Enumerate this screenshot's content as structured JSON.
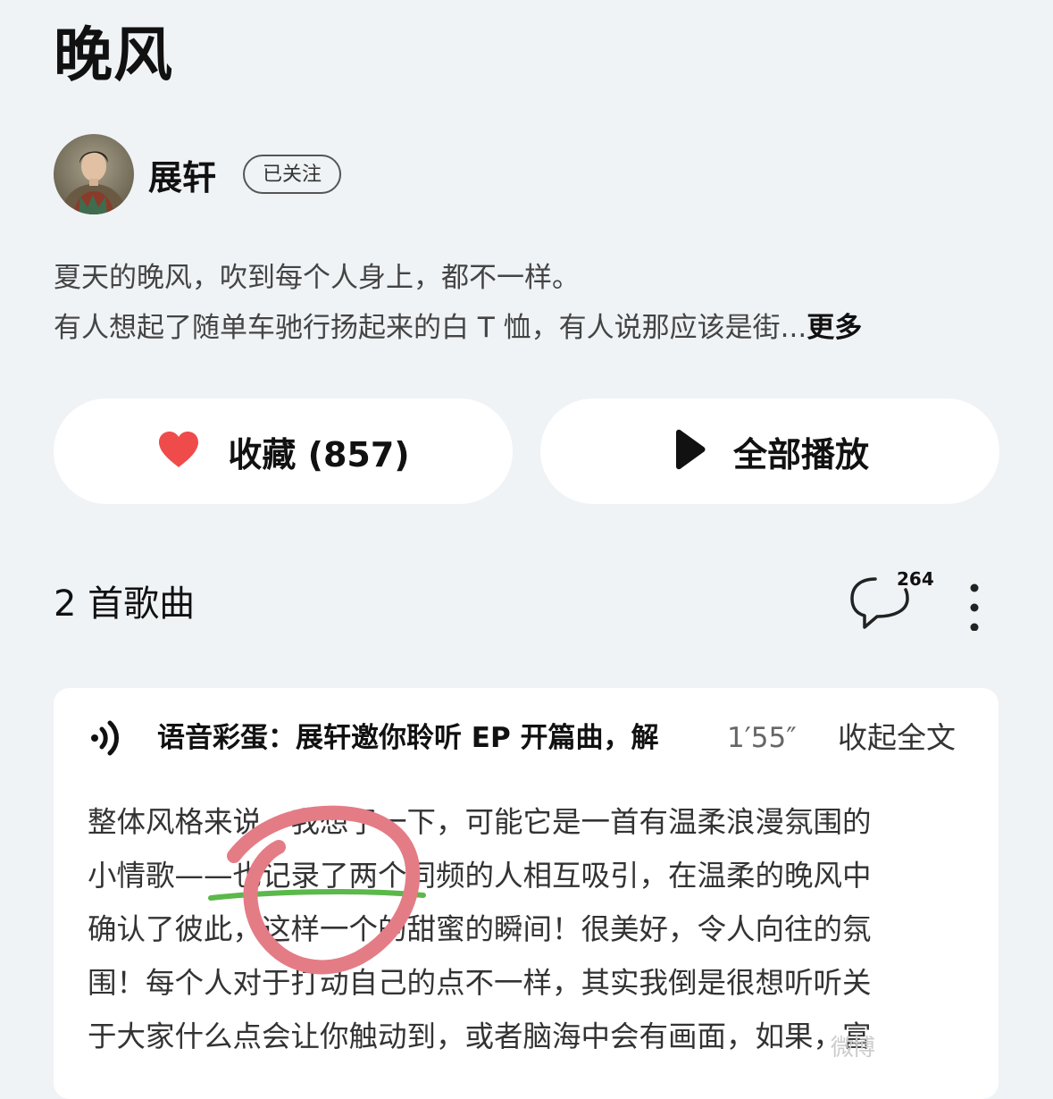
{
  "playlist": {
    "title": "晚风"
  },
  "artist": {
    "name": "展轩",
    "follow_status": "已关注"
  },
  "description": {
    "lines": [
      "夏天的晚风，吹到每个人身上，都不一样。",
      "有人想起了随单车驰行扬起来的白 T 恤，有人说那应该是街..."
    ],
    "more": "更多"
  },
  "actions": {
    "favorite_label": "收藏 (857)",
    "play_all_label": "全部播放"
  },
  "songs": {
    "count_label": "2 首歌曲",
    "comment_count": "264"
  },
  "voice_note": {
    "title": "语音彩蛋：展轩邀你聆听 EP 开篇曲，解",
    "duration": "1′55″",
    "collapse_label": "收起全文",
    "body_lines": [
      "整体风格来说，我想了一下，可能它是一首有温柔浪漫氛围的",
      "小情歌——也记录了两个同频的人相互吸引，在温柔的晚风中",
      "确认了彼此，这样一个的甜蜜的瞬间！很美好，令人向往的氛",
      "围！每个人对于打动自己的点不一样，其实我倒是很想听听关",
      "于大家什么点会让你触动到，或者脑海中会有画面，如果，富"
    ]
  },
  "colors": {
    "background": "#eff3f6",
    "heart": "#f04b4b",
    "annotation_circle": "#e47c86",
    "annotation_underline": "#5bb84a"
  },
  "icons": {
    "favorite": "heart-icon",
    "play": "play-icon",
    "comment": "comment-bubble-icon",
    "more": "more-vertical-icon",
    "audio": "audio-wave-icon"
  },
  "watermark": "微博"
}
